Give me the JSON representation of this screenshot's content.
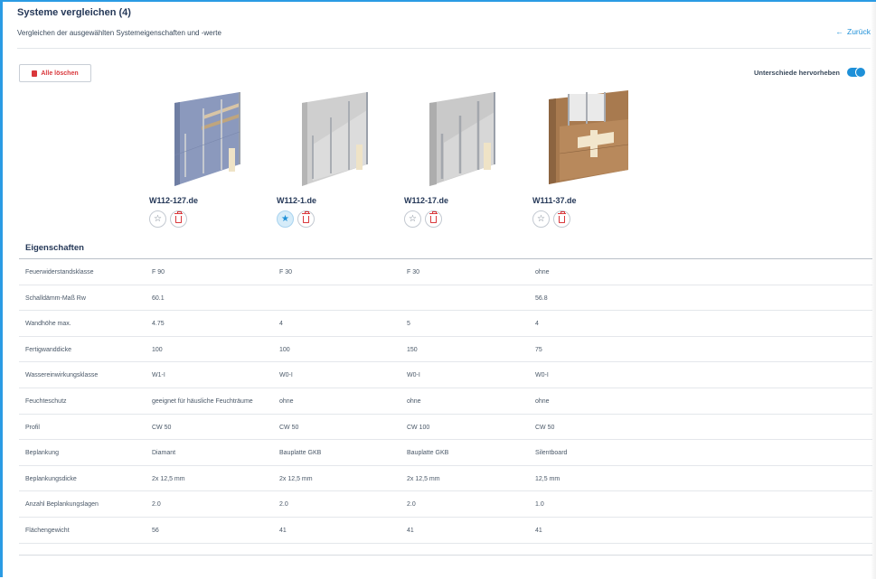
{
  "header": {
    "title": "Systeme vergleichen (4)",
    "subtitle": "Vergleichen der ausgewählten Systemeigenschaften und -werte",
    "back_arrow": "←",
    "back_label": "Zurück"
  },
  "toolbar": {
    "clear_all_label": "Alle löschen",
    "highlight_diff_label": "Unterschiede hervorheben",
    "highlight_diff_on": true
  },
  "products": [
    {
      "name": "W112-127.de",
      "favorite": false,
      "image": "drywall-diamond-blue"
    },
    {
      "name": "W112-1.de",
      "favorite": true,
      "image": "drywall-gkb-grey"
    },
    {
      "name": "W112-17.de",
      "favorite": false,
      "image": "drywall-gkb-grey-thick"
    },
    {
      "name": "W111-37.de",
      "favorite": false,
      "image": "drywall-silentboard-brown"
    }
  ],
  "icons": {
    "star_empty": "☆",
    "star_filled": "★"
  },
  "properties": {
    "section_title": "Eigenschaften",
    "rows": [
      {
        "label": "Feuerwiderstandsklasse",
        "values": [
          "F 90",
          "F 30",
          "F 30",
          "ohne"
        ]
      },
      {
        "label": "Schalldämm-Maß Rw",
        "values": [
          "60.1",
          "",
          "",
          "56.8"
        ]
      },
      {
        "label": "Wandhöhe max.",
        "values": [
          "4.75",
          "4",
          "5",
          "4"
        ]
      },
      {
        "label": "Fertigwanddicke",
        "values": [
          "100",
          "100",
          "150",
          "75"
        ]
      },
      {
        "label": "Wassereinwirkungsklasse",
        "values": [
          "W1-I",
          "W0-I",
          "W0-I",
          "W0-I"
        ]
      },
      {
        "label": "Feuchteschutz",
        "values": [
          "geeignet für häusliche Feuchträume",
          "ohne",
          "ohne",
          "ohne"
        ]
      },
      {
        "label": "Profil",
        "values": [
          "CW 50",
          "CW 50",
          "CW 100",
          "CW 50"
        ]
      },
      {
        "label": "Beplankung",
        "values": [
          "Diamant",
          "Bauplatte GKB",
          "Bauplatte GKB",
          "Silentboard"
        ]
      },
      {
        "label": "Beplankungsdicke",
        "values": [
          "2x 12,5 mm",
          "2x 12,5 mm",
          "2x 12,5 mm",
          "12,5 mm"
        ]
      },
      {
        "label": "Anzahl Beplankungslagen",
        "values": [
          "2.0",
          "2.0",
          "2.0",
          "1.0"
        ]
      },
      {
        "label": "Flächengewicht",
        "values": [
          "56",
          "41",
          "41",
          "41"
        ]
      }
    ]
  },
  "colors": {
    "accent": "#1e90d8",
    "danger": "#d9373b",
    "title": "#253858",
    "board_blue": "#8b99bd",
    "board_grey": "#c9c9c9",
    "board_brown": "#a87a4f"
  }
}
